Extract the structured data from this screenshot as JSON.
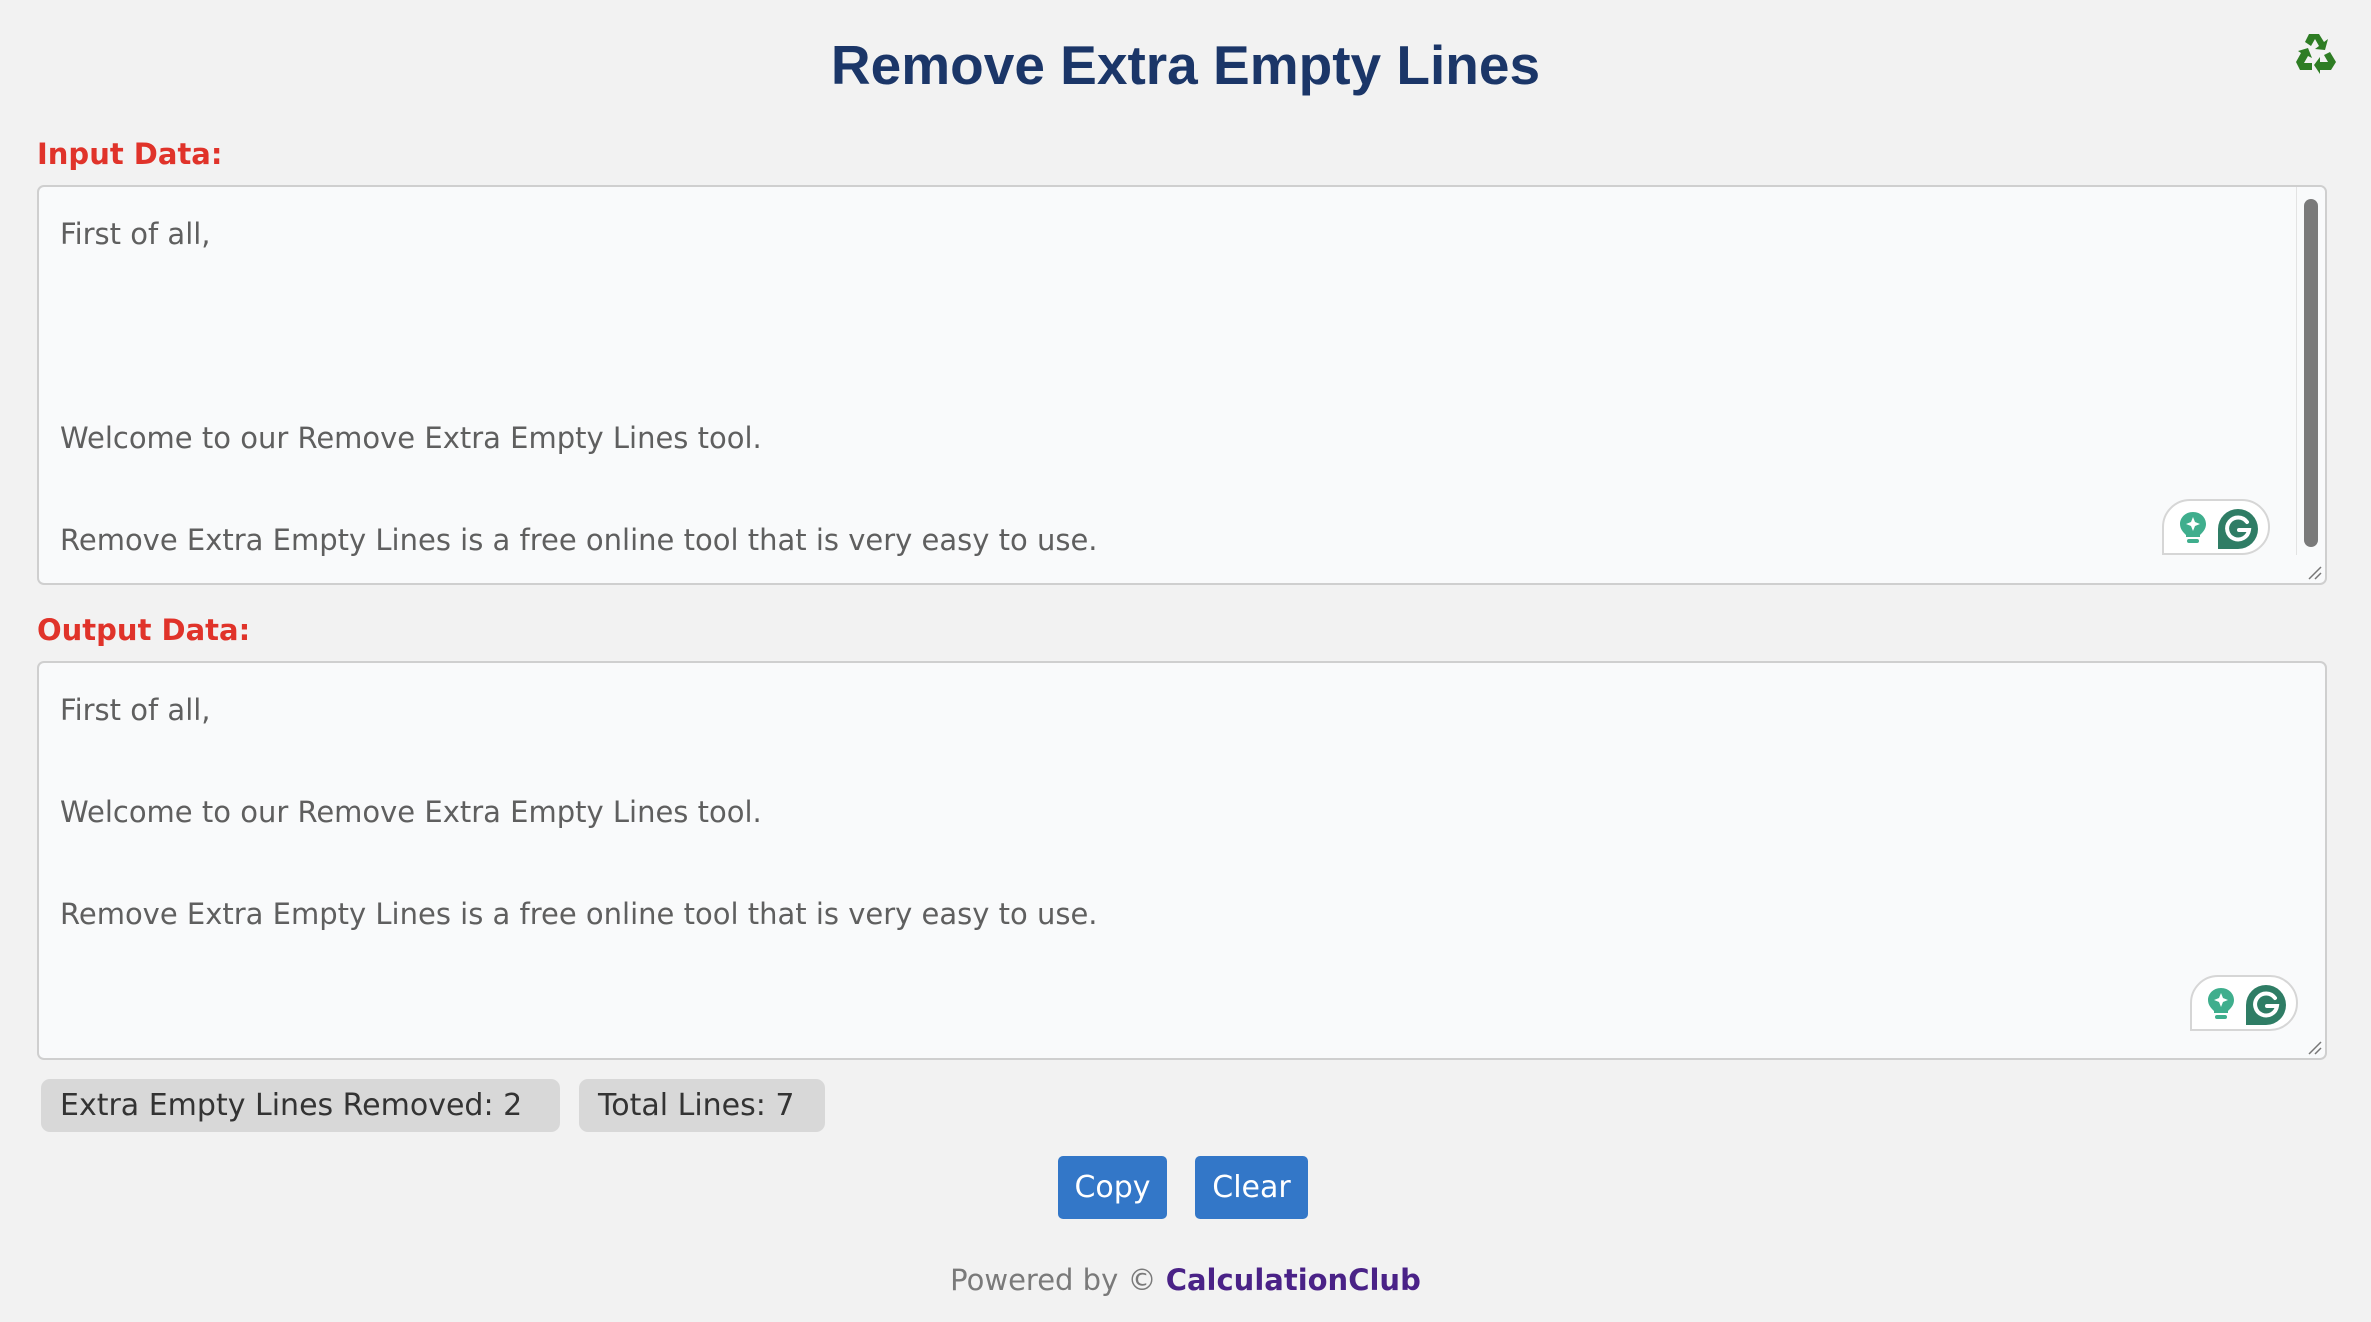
{
  "header": {
    "title": "Remove Extra Empty Lines",
    "reset_icon": "recycle-icon"
  },
  "input": {
    "label": "Input Data:",
    "lines": [
      "First of all,",
      "",
      "",
      "",
      "Welcome to our Remove Extra Empty Lines tool.",
      "",
      "Remove Extra Empty Lines is a free online tool that is very easy to use."
    ],
    "has_scrollbar": true,
    "assistant_widget": [
      "lightbulb-sparkle-icon",
      "grammarly-g-icon"
    ]
  },
  "output": {
    "label": "Output Data:",
    "lines": [
      "First of all,",
      "",
      "Welcome to our Remove Extra Empty Lines tool.",
      "",
      "Remove Extra Empty Lines is a free online tool that is very easy to use."
    ],
    "assistant_widget": [
      "lightbulb-sparkle-icon",
      "grammarly-g-icon"
    ]
  },
  "stats": {
    "removed_label": "Extra Empty Lines Removed: 2",
    "removed_count": 2,
    "total_label": "Total Lines: 7",
    "total_count": 7
  },
  "actions": {
    "copy_label": "Copy",
    "clear_label": "Clear"
  },
  "footer": {
    "prefix": "Powered by © ",
    "brand": "CalculationClub"
  },
  "colors": {
    "title": "#1b3668",
    "label": "#e0332a",
    "button": "#3377c8",
    "brand_link": "#4a2287",
    "recycle_icon": "#2e7d24",
    "grammarly": "#2f8a6d"
  }
}
